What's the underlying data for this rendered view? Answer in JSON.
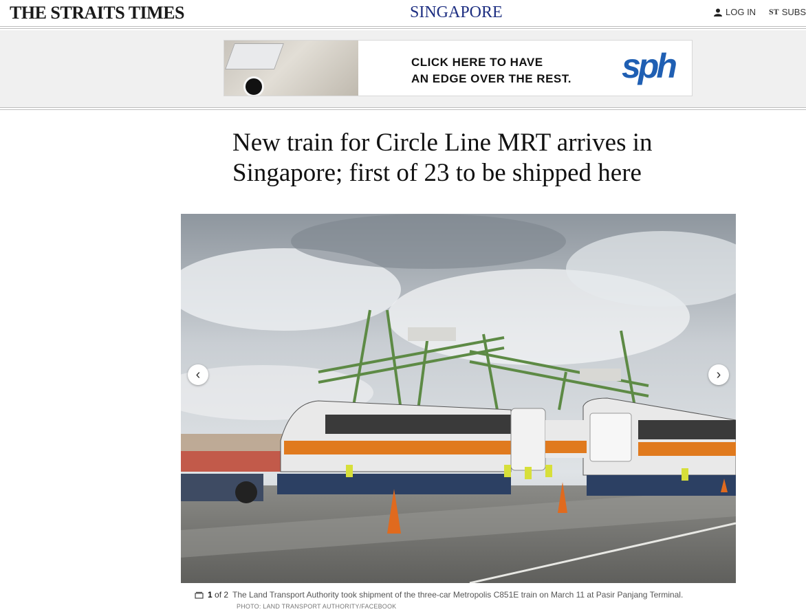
{
  "header": {
    "masthead": "THE STRAITS TIMES",
    "section": "SINGAPORE",
    "login_label": "LOG IN",
    "subscribe_label": "SUBSC",
    "subscribe_logo": "ST"
  },
  "ad": {
    "line1": "CLICK HERE TO HAVE",
    "line2": "AN EDGE OVER THE REST.",
    "brand": "sph",
    "colors": {
      "brand": "#1f5fb3"
    }
  },
  "article": {
    "headline": "New train for Circle Line MRT arrives in Singapore; first of 23 to be shipped here"
  },
  "gallery": {
    "current": "1",
    "total_label": "of 2",
    "caption": "The Land Transport Authority took shipment of the three-car Metropolis C851E train on March 11 at Pasir Panjang Terminal.",
    "credit": "PHOTO: LAND TRANSPORT AUTHORITY/FACEBOOK",
    "prev_icon": "chevron-left-icon",
    "next_icon": "chevron-right-icon"
  },
  "colors": {
    "section": "#1e2f82"
  }
}
